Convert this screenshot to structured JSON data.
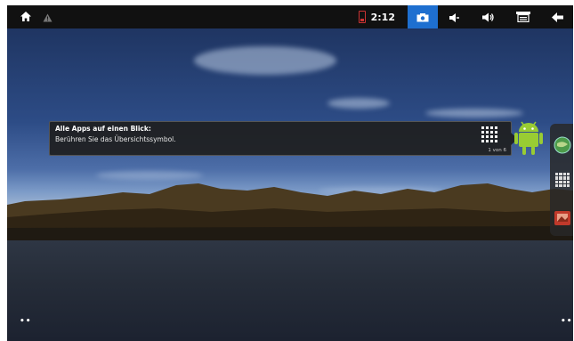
{
  "status_bar": {
    "clock": "2:12",
    "icons": [
      "home-icon",
      "warning-icon",
      "battery-icon",
      "screenshot-icon",
      "volume-down-icon",
      "volume-up-icon",
      "menu-icon",
      "back-icon"
    ],
    "active_color": "#1e6fd0"
  },
  "tooltip": {
    "title": "Alle Apps auf einen Blick:",
    "body": "Berühren Sie das Übersichtssymbol.",
    "page": "1 von 6"
  },
  "dock": {
    "items": [
      "browser-icon",
      "apps-grid-icon",
      "gallery-icon"
    ]
  }
}
